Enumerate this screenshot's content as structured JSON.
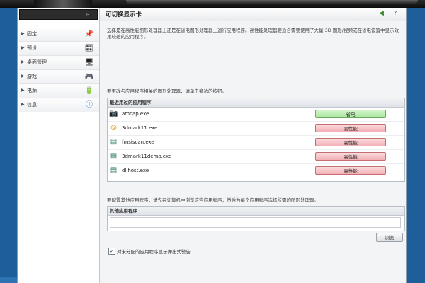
{
  "window": {
    "title": "可切换显示卡"
  },
  "search": {
    "placeholder": ""
  },
  "sidebar": {
    "items": [
      {
        "label": "固定",
        "icon": "pin-icon",
        "glyph": "📌"
      },
      {
        "label": "预设",
        "icon": "preset-icon",
        "glyph": "🎛"
      },
      {
        "label": "桌面管理",
        "icon": "desktop-icon",
        "glyph": "🖥"
      },
      {
        "label": "游戏",
        "icon": "gamepad-icon",
        "glyph": "🎮"
      },
      {
        "label": "电源",
        "icon": "battery-icon",
        "glyph": "🔋"
      },
      {
        "label": "信息",
        "icon": "info-icon",
        "glyph": "ⓘ"
      }
    ]
  },
  "main": {
    "description": "选择是在高性能图形处理器上还是在省电图形处理器上运行应用程序。高性能处理器要适合需要使用了大量 3D 图形/视频或在省电设置中显示效果较差的应用程序。",
    "instruction": "要更改与应用程序相关的图形处理器，请单击旁边的按钮。",
    "recent_apps": {
      "header": "最近用过的应用程序",
      "rows": [
        {
          "name": "amcap.exe",
          "mode": "省电",
          "kind": "low",
          "icon": "webcam-icon",
          "glyph": "📷"
        },
        {
          "name": "3dmark11.exe",
          "mode": "高性能",
          "kind": "high",
          "icon": "3dmark-icon",
          "glyph": "◎"
        },
        {
          "name": "fmsiscan.exe",
          "mode": "高性能",
          "kind": "high",
          "icon": "app-file-icon",
          "glyph": "▤"
        },
        {
          "name": "3dmark11demo.exe",
          "mode": "高性能",
          "kind": "high",
          "icon": "app-file-icon",
          "glyph": "▤"
        },
        {
          "name": "dllhost.exe",
          "mode": "高性能",
          "kind": "high",
          "icon": "app-file-icon",
          "glyph": "▤"
        }
      ]
    },
    "other_instruction": "要配置其他应用程序，请先在计算机中浏览这些应用程序，然后为每个应用程序选择所需的图形处理器。",
    "other_apps": {
      "header": "其他应用程序",
      "path_value": ""
    },
    "browse_label": "浏览",
    "checkbox": {
      "label": "对未分配的应用程序显示弹出式警告",
      "checked": true,
      "mark": "✓"
    }
  },
  "colors": {
    "low_power": "#a9e79d",
    "high_performance": "#f3b0b5",
    "desktop": "#1f5f99"
  }
}
